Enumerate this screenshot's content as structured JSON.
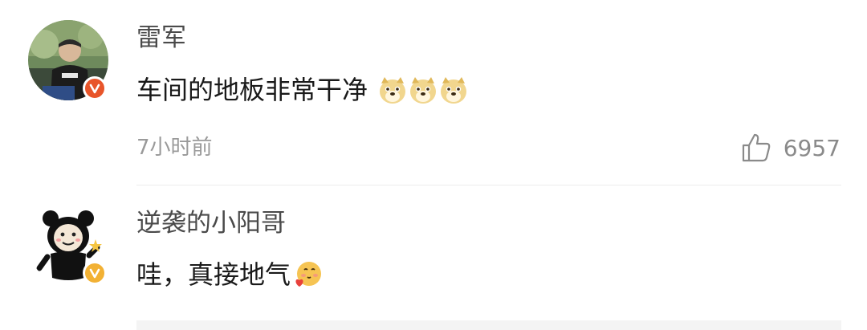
{
  "comments": [
    {
      "username": "雷军",
      "text": "车间的地板非常干净",
      "emoji_names": [
        "doge-emoji",
        "doge-emoji",
        "doge-emoji"
      ],
      "timestamp": "7小时前",
      "like_count": "6957",
      "badge_color": "#e8552a"
    },
    {
      "username": "逆袭的小阳哥",
      "text": "哇，真接地气",
      "emoji_names": [
        "heart-emoji"
      ],
      "badge_color": "#f2b134"
    }
  ],
  "colors": {
    "username": "#4a4a4a",
    "text": "#1a1a1a",
    "meta": "#9a9a9a"
  }
}
